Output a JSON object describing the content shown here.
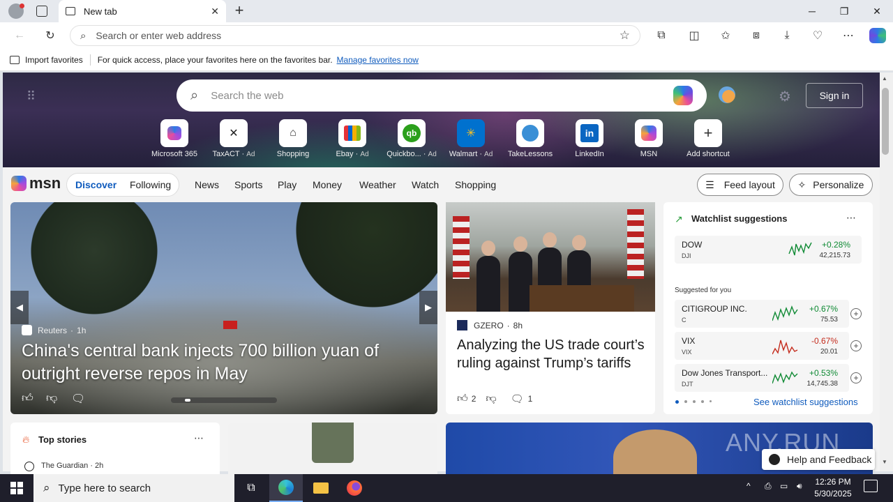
{
  "browser": {
    "tab_title": "New tab",
    "address_placeholder": "Search or enter web address"
  },
  "favorites_bar": {
    "import_label": "Import favorites",
    "message": "For quick access, place your favorites here on the favorites bar.",
    "manage_link": "Manage favorites now"
  },
  "hero": {
    "search_placeholder": "Search the web",
    "signin_label": "Sign in",
    "shortcuts": [
      {
        "label": "Microsoft 365",
        "ad": ""
      },
      {
        "label": "TaxACT",
        "ad": "Ad"
      },
      {
        "label": "Shopping",
        "ad": ""
      },
      {
        "label": "Ebay",
        "ad": "Ad"
      },
      {
        "label": "Quickbo...",
        "ad": "Ad"
      },
      {
        "label": "Walmart",
        "ad": "Ad"
      },
      {
        "label": "TakeLessons",
        "ad": ""
      },
      {
        "label": "LinkedIn",
        "ad": ""
      },
      {
        "label": "MSN",
        "ad": ""
      },
      {
        "label": "Add shortcut",
        "ad": ""
      }
    ]
  },
  "msn": {
    "logo": "msn",
    "tabs": {
      "discover": "Discover",
      "following": "Following"
    },
    "nav": [
      "News",
      "Sports",
      "Play",
      "Money",
      "Weather",
      "Watch",
      "Shopping"
    ],
    "feed_layout": "Feed layout",
    "personalize": "Personalize"
  },
  "hero_story": {
    "source": "Reuters",
    "age": "1h",
    "headline": "China's central bank injects 700 billion yuan of outright reverse repos in May"
  },
  "side_story": {
    "source": "GZERO",
    "age": "8h",
    "headline": "Analyzing the US trade court’s ruling against Trump’s tariffs",
    "likes": "2",
    "comments": "1"
  },
  "watchlist": {
    "title": "Watchlist suggestions",
    "suggested_label": "Suggested for you",
    "see_more": "See watchlist suggestions",
    "colors": {
      "up": "#0f8a34",
      "down": "#c42b1c"
    },
    "items": [
      {
        "name": "DOW",
        "symbol": "DJI",
        "change": "+0.28%",
        "value": "42,215.73",
        "dir": "up"
      },
      {
        "name": "CITIGROUP INC.",
        "symbol": "C",
        "change": "+0.67%",
        "value": "75.53",
        "dir": "up"
      },
      {
        "name": "VIX",
        "symbol": "VIX",
        "change": "-0.67%",
        "value": "20.01",
        "dir": "down"
      },
      {
        "name": "Dow Jones Transport...",
        "symbol": "DJT",
        "change": "+0.53%",
        "value": "14,745.38",
        "dir": "up"
      }
    ]
  },
  "top_stories": {
    "title": "Top stories",
    "source": "The Guardian",
    "age": "2h"
  },
  "help": {
    "label": "Help and Feedback"
  },
  "watermark": "ANY.RUN",
  "taskbar": {
    "search_placeholder": "Type here to search",
    "time": "12:26 PM",
    "date": "5/30/2025"
  }
}
